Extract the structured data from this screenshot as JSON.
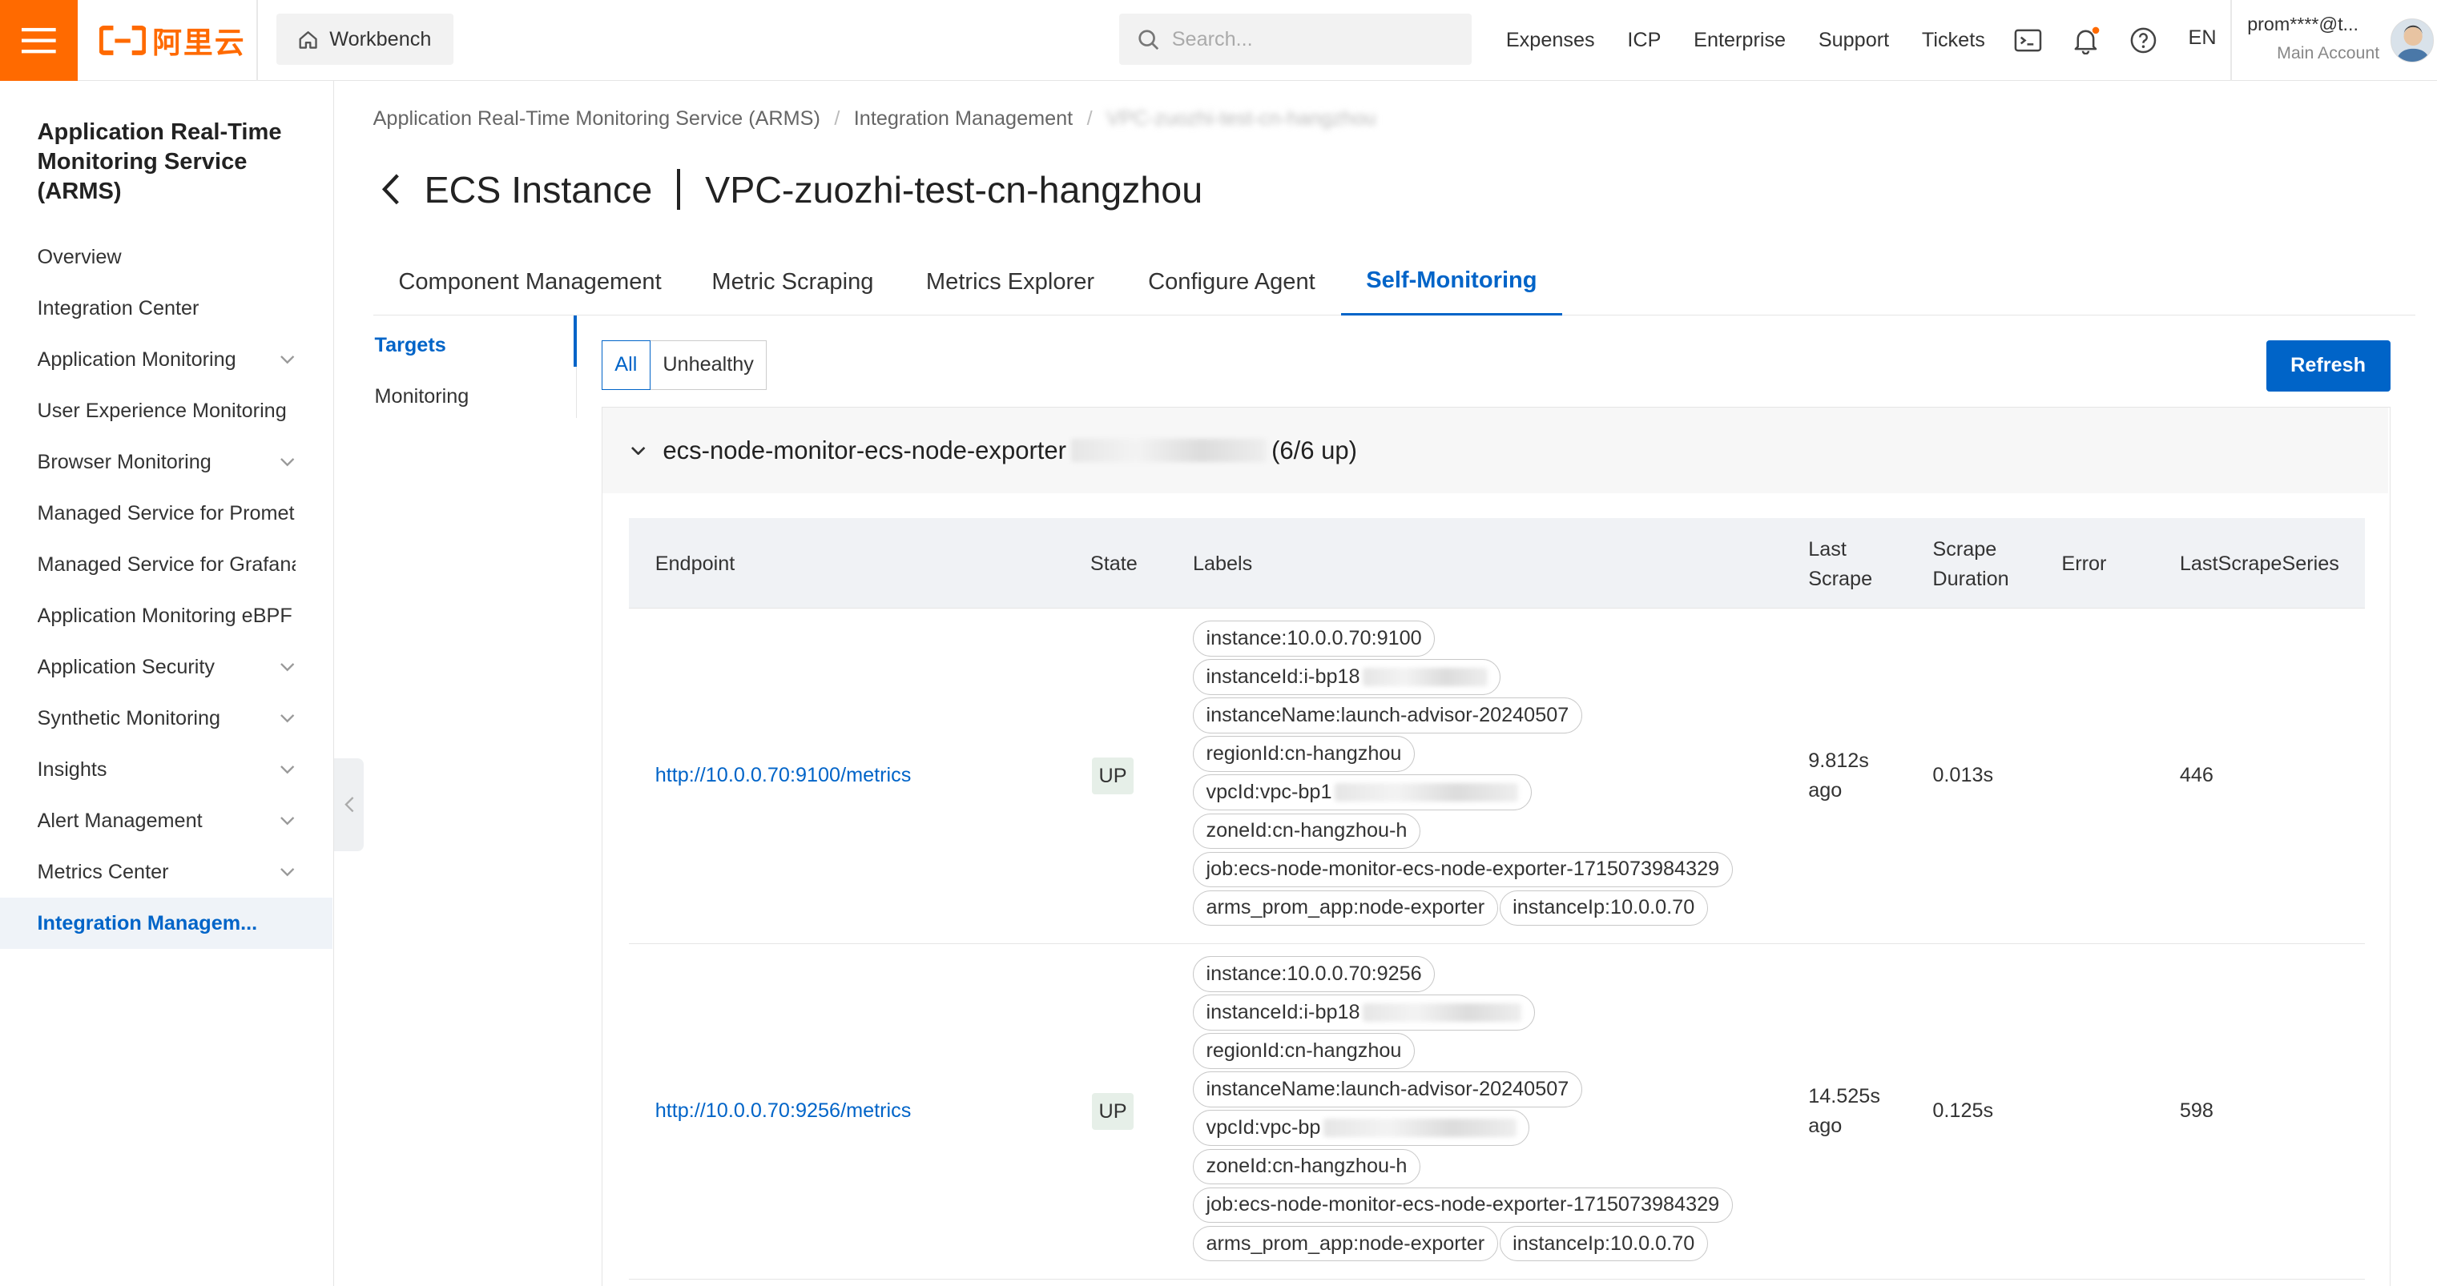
{
  "topbar": {
    "logo_text": "阿里云",
    "workbench_label": "Workbench",
    "search_placeholder": "Search...",
    "links": [
      "Expenses",
      "ICP",
      "Enterprise",
      "Support",
      "Tickets"
    ],
    "lang": "EN",
    "account_name": "prom****@t...",
    "account_type": "Main Account",
    "accent_color": "#ff6a00"
  },
  "sidebar": {
    "title": "Application Real-Time Monitoring Service (ARMS)",
    "items": [
      {
        "label": "Overview",
        "has_chevron": false
      },
      {
        "label": "Integration Center",
        "has_chevron": false
      },
      {
        "label": "Application Monitoring",
        "has_chevron": true
      },
      {
        "label": "User Experience Monitoring",
        "has_chevron": false
      },
      {
        "label": "Browser Monitoring",
        "has_chevron": true
      },
      {
        "label": "Managed Service for Prometheus",
        "has_chevron": false
      },
      {
        "label": "Managed Service for Grafana",
        "has_chevron": false
      },
      {
        "label": "Application Monitoring eBPF",
        "has_chevron": false
      },
      {
        "label": "Application Security",
        "has_chevron": true
      },
      {
        "label": "Synthetic Monitoring",
        "has_chevron": true
      },
      {
        "label": "Insights",
        "has_chevron": true
      },
      {
        "label": "Alert Management",
        "has_chevron": true
      },
      {
        "label": "Metrics Center",
        "has_chevron": true
      },
      {
        "label": "Integration Managem...",
        "has_chevron": false,
        "active": true
      }
    ]
  },
  "breadcrumb": [
    "Application Real-Time Monitoring Service (ARMS)",
    "Integration Management",
    "VPC-zuozhi-test-cn-hangzhou"
  ],
  "header": {
    "title": "ECS Instance",
    "instance": "VPC-zuozhi-test-cn-hangzhou"
  },
  "tabs": [
    "Component Management",
    "Metric Scraping",
    "Metrics Explorer",
    "Configure Agent",
    "Self-Monitoring"
  ],
  "active_tab": "Self-Monitoring",
  "subnav": {
    "items": [
      "Targets",
      "Monitoring"
    ],
    "active": "Targets"
  },
  "filters": {
    "all": "All",
    "unhealthy": "Unhealthy",
    "active": "All"
  },
  "refresh_label": "Refresh",
  "target_group": {
    "name": "ecs-node-monitor-ecs-node-exporter",
    "status": "(6/6 up)"
  },
  "table": {
    "headers": {
      "endpoint": "Endpoint",
      "state": "State",
      "labels": "Labels",
      "last_scrape": "Last Scrape",
      "scrape_duration": "Scrape Duration",
      "error": "Error",
      "last_scrape_series": "LastScrapeSeries"
    },
    "rows": [
      {
        "endpoint": "http://10.0.0.70:9100/metrics",
        "state": "UP",
        "last_scrape": "9.812s ago",
        "scrape_duration": "0.013s",
        "error": "",
        "series": "446",
        "labels": [
          {
            "text": "instance:10.0.0.70:9100"
          },
          {
            "text": "instanceId:i-bp18"
          },
          {
            "text": "instanceName:launch-advisor-20240507"
          },
          {
            "text": "regionId:cn-hangzhou"
          },
          {
            "text": "vpcId:vpc-bp1"
          },
          {
            "text": "zoneId:cn-hangzhou-h"
          },
          {
            "text": "job:ecs-node-monitor-ecs-node-exporter-1715073984329"
          },
          {
            "text": "arms_prom_app:node-exporter"
          },
          {
            "text": "instanceIp:10.0.0.70"
          }
        ]
      },
      {
        "endpoint": "http://10.0.0.70:9256/metrics",
        "state": "UP",
        "last_scrape": "14.525s ago",
        "scrape_duration": "0.125s",
        "error": "",
        "series": "598",
        "labels": [
          {
            "text": "instance:10.0.0.70:9256"
          },
          {
            "text": "instanceId:i-bp18"
          },
          {
            "text": "regionId:cn-hangzhou"
          },
          {
            "text": "instanceName:launch-advisor-20240507"
          },
          {
            "text": "vpcId:vpc-bp"
          },
          {
            "text": "zoneId:cn-hangzhou-h"
          },
          {
            "text": "job:ecs-node-monitor-ecs-node-exporter-1715073984329"
          },
          {
            "text": "arms_prom_app:node-exporter"
          },
          {
            "text": "instanceIp:10.0.0.70"
          }
        ]
      }
    ]
  }
}
